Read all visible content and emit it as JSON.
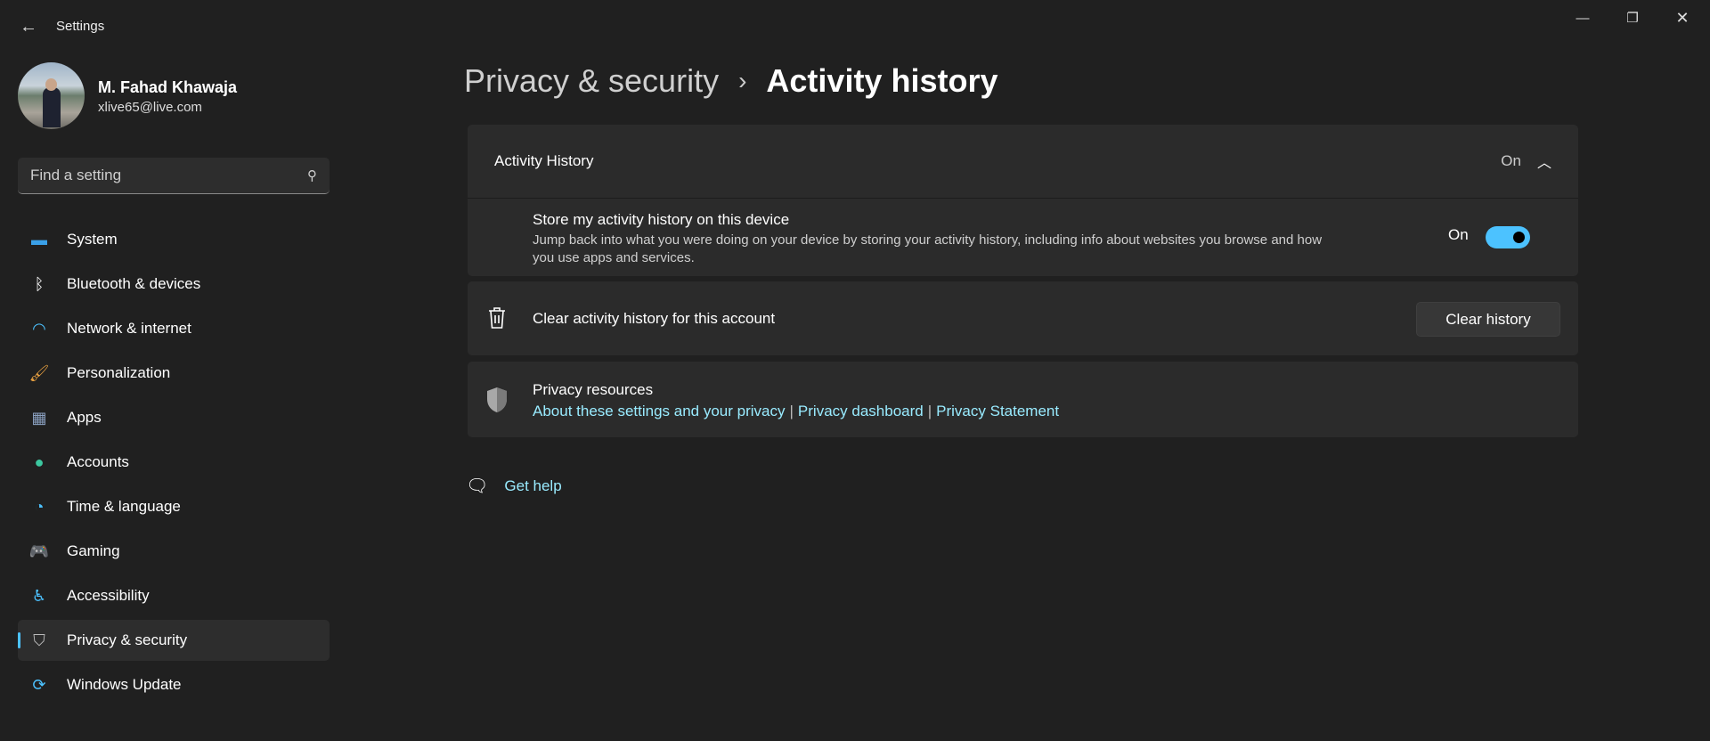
{
  "titlebar": {
    "title": "Settings",
    "back_icon": "arrow-left",
    "controls": [
      "minimize",
      "restore",
      "close"
    ]
  },
  "user": {
    "name": "M. Fahad Khawaja",
    "email": "xlive65@live.com"
  },
  "search": {
    "placeholder": "Find a setting"
  },
  "sidebar": {
    "items": [
      {
        "label": "System",
        "icon": "monitor"
      },
      {
        "label": "Bluetooth & devices",
        "icon": "bluetooth"
      },
      {
        "label": "Network & internet",
        "icon": "wifi"
      },
      {
        "label": "Personalization",
        "icon": "brush"
      },
      {
        "label": "Apps",
        "icon": "apps"
      },
      {
        "label": "Accounts",
        "icon": "person"
      },
      {
        "label": "Time & language",
        "icon": "clock-globe"
      },
      {
        "label": "Gaming",
        "icon": "gamepad"
      },
      {
        "label": "Accessibility",
        "icon": "accessibility"
      },
      {
        "label": "Privacy & security",
        "icon": "shield",
        "selected": true
      },
      {
        "label": "Windows Update",
        "icon": "refresh"
      }
    ]
  },
  "breadcrumb": {
    "parent": "Privacy & security",
    "separator": "›",
    "current": "Activity history"
  },
  "activity": {
    "header": "Activity History",
    "header_state": "On",
    "store_title": "Store my activity history on this device",
    "store_desc": "Jump back into what you were doing on your device by storing your activity history, including info about websites you browse and how you use apps and services.",
    "toggle_label": "On",
    "toggle_on": true
  },
  "clear": {
    "label": "Clear activity history for this account",
    "button": "Clear history"
  },
  "resources": {
    "title": "Privacy resources",
    "links": [
      "About these settings and your privacy",
      "Privacy dashboard",
      "Privacy Statement"
    ],
    "sep": "|"
  },
  "help": {
    "label": "Get help"
  },
  "colors": {
    "accent": "#4cc2ff",
    "link": "#99ebff",
    "bg": "#202020",
    "card": "#2b2b2b"
  }
}
